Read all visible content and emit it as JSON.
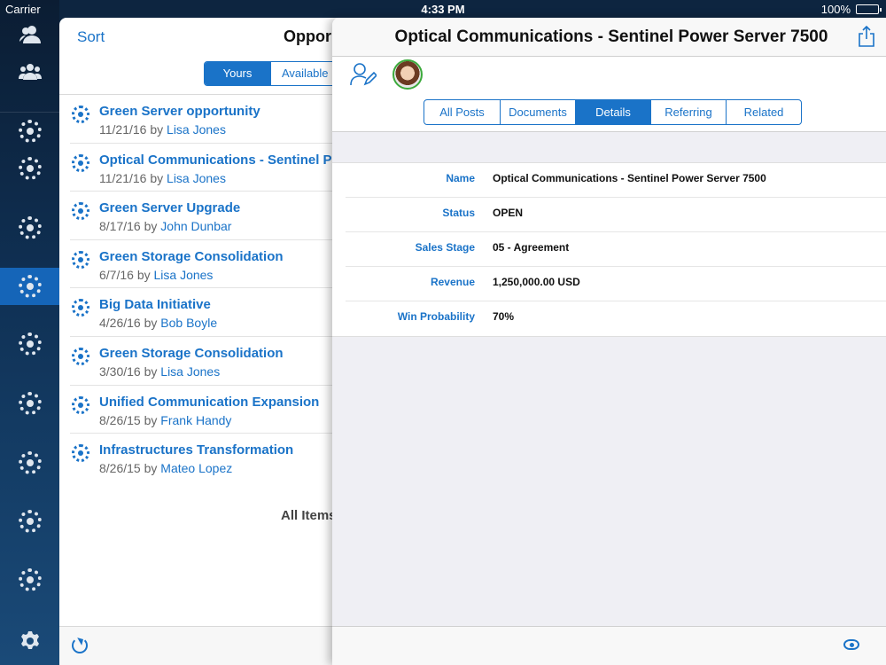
{
  "status_bar": {
    "carrier": "Carrier",
    "time": "4:33 PM",
    "battery": "100%"
  },
  "rail": {
    "items": [
      {
        "icon": "person-icon"
      },
      {
        "icon": "group-icon"
      },
      {
        "icon": "ring-icon"
      },
      {
        "icon": "ring-icon"
      },
      {
        "icon": "ring-icon"
      },
      {
        "icon": "ring-icon",
        "active": true
      },
      {
        "icon": "ring-icon"
      },
      {
        "icon": "ring-icon"
      },
      {
        "icon": "ring-icon"
      },
      {
        "icon": "ring-icon"
      },
      {
        "icon": "ring-icon"
      },
      {
        "icon": "gear-icon"
      }
    ]
  },
  "master": {
    "sort_label": "Sort",
    "title": "Oppor",
    "segments": [
      "Yours",
      "Available"
    ],
    "items": [
      {
        "title": "Green Server opportunity",
        "date": "11/21/16 by ",
        "owner": "Lisa Jones"
      },
      {
        "title": "Optical Communications - Sentinel Po",
        "date": "11/21/16 by ",
        "owner": "Lisa Jones"
      },
      {
        "title": "Green Server Upgrade",
        "date": "8/17/16 by ",
        "owner": "John Dunbar"
      },
      {
        "title": "Green Storage Consolidation",
        "date": "6/7/16 by ",
        "owner": "Lisa Jones"
      },
      {
        "title": "Big Data Initiative",
        "date": "4/26/16 by ",
        "owner": "Bob Boyle"
      },
      {
        "title": "Green Storage Consolidation",
        "date": "3/30/16 by ",
        "owner": "Lisa Jones"
      },
      {
        "title": "Unified Communication Expansion",
        "date": "8/26/15 by ",
        "owner": "Frank Handy"
      },
      {
        "title": "Infrastructures Transformation",
        "date": "8/26/15 by ",
        "owner": "Mateo Lopez"
      }
    ],
    "footer_text": "All Items"
  },
  "detail": {
    "title": "Optical Communications - Sentinel Power Server 7500",
    "tabs": [
      "All Posts",
      "Documents",
      "Details",
      "Referring",
      "Related"
    ],
    "fields": [
      {
        "label": "Name",
        "value": "Optical Communications - Sentinel Power Server 7500"
      },
      {
        "label": "Status",
        "value": "OPEN"
      },
      {
        "label": "Sales Stage",
        "value": "05 - Agreement"
      },
      {
        "label": "Revenue",
        "value": "1,250,000.00 USD"
      },
      {
        "label": "Win Probability",
        "value": "70%"
      }
    ]
  },
  "colors": {
    "accent": "#1a73c8",
    "rail_active": "#1565b8"
  }
}
